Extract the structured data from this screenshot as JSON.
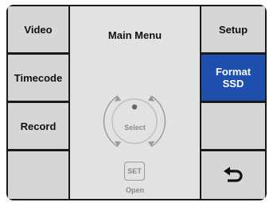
{
  "left_buttons": [
    {
      "label": "Video"
    },
    {
      "label": "Timecode"
    },
    {
      "label": "Record"
    },
    {
      "label": ""
    }
  ],
  "center": {
    "title": "Main Menu",
    "dial_label": "Select",
    "set_label": "SET",
    "open_label": "Open"
  },
  "right_buttons": [
    {
      "label": "Setup"
    },
    {
      "label": "Format\nSSD",
      "active": true
    },
    {
      "label": ""
    },
    {
      "label": "",
      "icon": "back-arrow-icon"
    }
  ],
  "colors": {
    "active": "#1f4fae",
    "button": "#d6d6d6",
    "frame": "#1a1a1a"
  }
}
